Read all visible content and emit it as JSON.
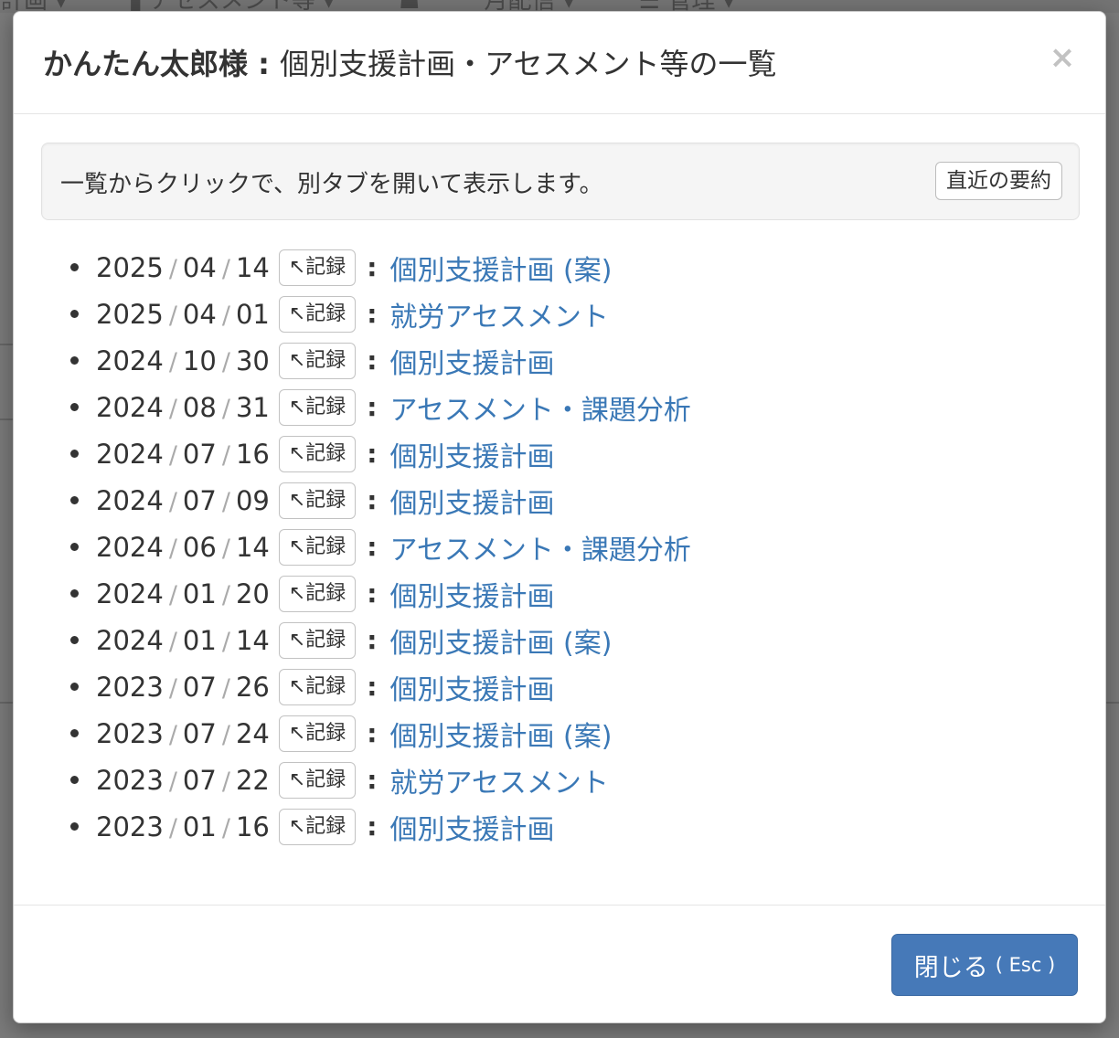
{
  "background": {
    "nav_items": [
      "計画 ▾",
      "▌アセスメント等 ▾",
      "☗",
      "月配信 ▾",
      "☰ 管理 ▾"
    ]
  },
  "modal": {
    "title_name": "かんたん太郎様",
    "title_sep": " : ",
    "title_text": "個別支援計画・アセスメント等の一覧",
    "close_glyph": "×",
    "info_text": "一覧からクリックで、別タブを開いて表示します。",
    "summary_button": "直近の要約",
    "record_button": "↖記録",
    "items": [
      {
        "y": "2025",
        "m": "04",
        "d": "14",
        "title": "個別支援計画 (案)"
      },
      {
        "y": "2025",
        "m": "04",
        "d": "01",
        "title": "就労アセスメント"
      },
      {
        "y": "2024",
        "m": "10",
        "d": "30",
        "title": "個別支援計画"
      },
      {
        "y": "2024",
        "m": "08",
        "d": "31",
        "title": "アセスメント・課題分析"
      },
      {
        "y": "2024",
        "m": "07",
        "d": "16",
        "title": "個別支援計画"
      },
      {
        "y": "2024",
        "m": "07",
        "d": "09",
        "title": "個別支援計画"
      },
      {
        "y": "2024",
        "m": "06",
        "d": "14",
        "title": "アセスメント・課題分析"
      },
      {
        "y": "2024",
        "m": "01",
        "d": "20",
        "title": "個別支援計画"
      },
      {
        "y": "2024",
        "m": "01",
        "d": "14",
        "title": "個別支援計画 (案)"
      },
      {
        "y": "2023",
        "m": "07",
        "d": "26",
        "title": "個別支援計画"
      },
      {
        "y": "2023",
        "m": "07",
        "d": "24",
        "title": "個別支援計画 (案)"
      },
      {
        "y": "2023",
        "m": "07",
        "d": "22",
        "title": "就労アセスメント"
      },
      {
        "y": "2023",
        "m": "01",
        "d": "16",
        "title": "個別支援計画"
      }
    ],
    "footer_close_label": "閉じる",
    "footer_close_hint": "( Esc )"
  },
  "colors": {
    "link": "#3a78b6",
    "primary_button": "#4679b8",
    "overlay": "#7a7a7a"
  }
}
